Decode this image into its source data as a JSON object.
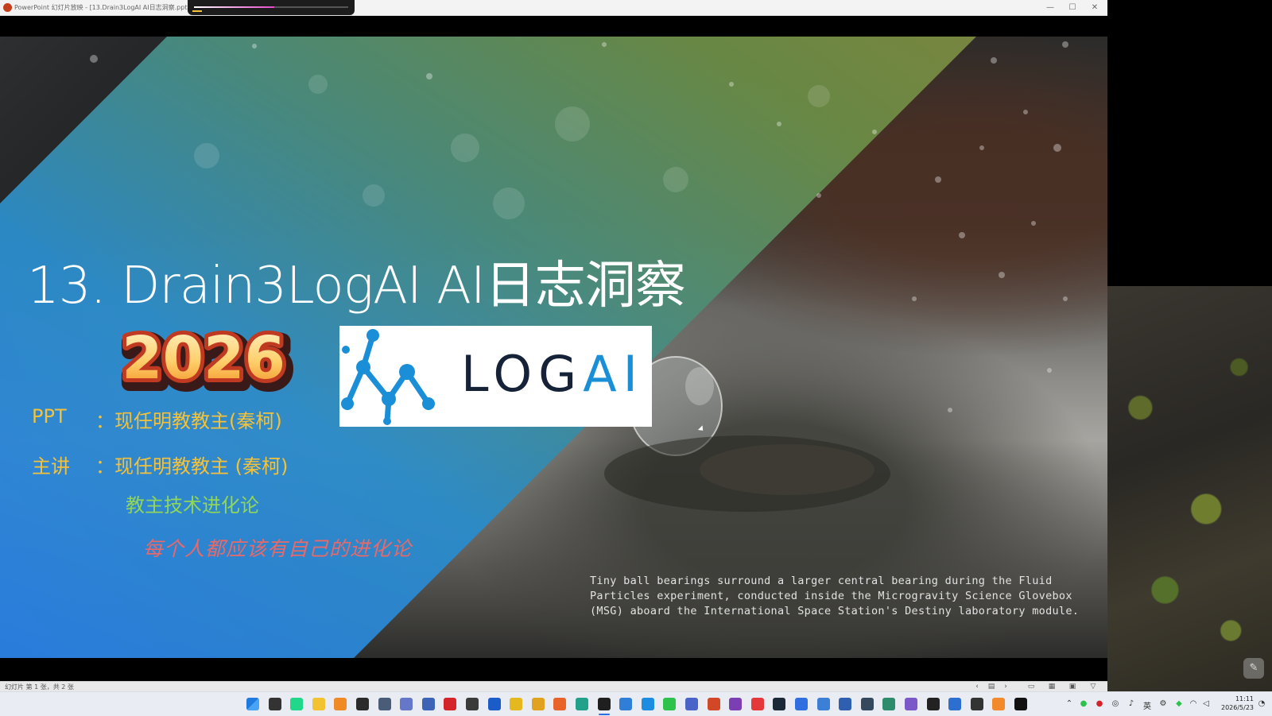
{
  "window": {
    "title": "PowerPoint 幻灯片放映 - [13.Drain3LogAI AI日志洞察.pptx] - PowerPoint",
    "minimize_icon": "—",
    "maximize_icon": "☐",
    "close_icon": "✕"
  },
  "playback": {
    "progress": 0.52
  },
  "slide": {
    "title": "13. Drain3LogAI AI日志洞察",
    "year": "2026",
    "logo": {
      "text_a": "LOG",
      "text_b": "AI"
    },
    "ppt_label": "PPT",
    "ppt_value": "：现任明教教主(秦柯)",
    "speaker_label": "主讲",
    "speaker_value": "：现任明教教主 (秦柯)",
    "tagline": "教主技术进化论",
    "motto": "每个人都应该有自己的进化论",
    "caption": "Tiny ball bearings surround a larger central bearing during the Fluid Particles experiment, conducted inside the Microgravity Science Glovebox (MSG) aboard the International Space Station's Destiny laboratory module."
  },
  "statusbar": {
    "slide_info": "幻灯片 第 1 张，共 2 张",
    "prev_icon": "‹",
    "next_icon": "›",
    "notes_icon": "▤",
    "normal_view_icon": "▭",
    "sorter_view_icon": "▦",
    "reading_view_icon": "▣",
    "slideshow_icon": "▽"
  },
  "taskbar": {
    "apps": [
      {
        "name": "start",
        "color": "#1f7ae0"
      },
      {
        "name": "task-view",
        "color": "#333333"
      },
      {
        "name": "pycharm",
        "color": "#21d789"
      },
      {
        "name": "file-explorer",
        "color": "#f2c231"
      },
      {
        "name": "sublime",
        "color": "#f08a24"
      },
      {
        "name": "terminal",
        "color": "#2b2b2b"
      },
      {
        "name": "remote-desktop",
        "color": "#4a5d78"
      },
      {
        "name": "network-tool",
        "color": "#6477c8"
      },
      {
        "name": "hyper-v",
        "color": "#3c63b5"
      },
      {
        "name": "recorder",
        "color": "#d4242a"
      },
      {
        "name": "obs",
        "color": "#3a3a3a"
      },
      {
        "name": "zoom-it",
        "color": "#1c5cc9"
      },
      {
        "name": "wechat-dev",
        "color": "#e4b81e"
      },
      {
        "name": "chrome",
        "color": "#e0a21f"
      },
      {
        "name": "firefox",
        "color": "#e8632a"
      },
      {
        "name": "edge",
        "color": "#22a18a"
      },
      {
        "name": "powerpoint-active",
        "color": "#1f1f1f"
      },
      {
        "name": "meet",
        "color": "#2f7fd8"
      },
      {
        "name": "vscode-like",
        "color": "#1c8de0"
      },
      {
        "name": "wechat",
        "color": "#2cc24b"
      },
      {
        "name": "teams",
        "color": "#4a63c9"
      },
      {
        "name": "powerpoint",
        "color": "#d24726"
      },
      {
        "name": "onenote",
        "color": "#7b3fb3"
      },
      {
        "name": "music",
        "color": "#e5383b"
      },
      {
        "name": "steam",
        "color": "#1b2838"
      },
      {
        "name": "vpn",
        "color": "#2f6fe0"
      },
      {
        "name": "wireshark",
        "color": "#3b7fd6"
      },
      {
        "name": "virtualbox",
        "color": "#2f5fb0"
      },
      {
        "name": "putty",
        "color": "#34495e"
      },
      {
        "name": "network-monitor",
        "color": "#2c8c6c"
      },
      {
        "name": "browser-2",
        "color": "#7a58c8"
      },
      {
        "name": "notion",
        "color": "#222222"
      },
      {
        "name": "code-editor",
        "color": "#2d6fd0"
      },
      {
        "name": "cmd",
        "color": "#333333"
      },
      {
        "name": "store",
        "color": "#f28a2b"
      },
      {
        "name": "media-player",
        "color": "#111111"
      }
    ],
    "tray": {
      "chevron_icon": "⌃",
      "ime": "英",
      "time": "11:11",
      "date": "2026/5/23"
    }
  }
}
